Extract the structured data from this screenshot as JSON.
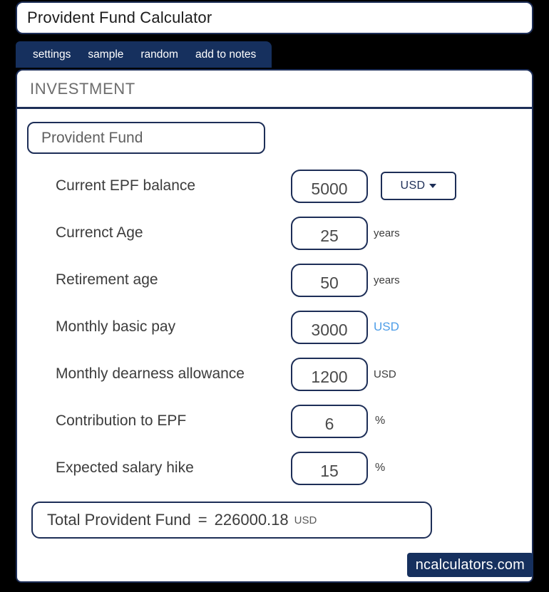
{
  "window": {
    "title": "Provident Fund Calculator"
  },
  "tabs": [
    {
      "label": "settings",
      "name": "tab-settings"
    },
    {
      "label": "sample",
      "name": "tab-sample"
    },
    {
      "label": "random",
      "name": "tab-random"
    },
    {
      "label": "add to notes",
      "name": "tab-add-to-notes"
    }
  ],
  "section": {
    "title": "INVESTMENT"
  },
  "investment_type": {
    "selected": "Provident Fund"
  },
  "fields": [
    {
      "label": "Current EPF balance",
      "value": "5000",
      "unit": "",
      "unit_style": "none",
      "has_currency_dropdown": true
    },
    {
      "label": "Currenct Age",
      "value": "25",
      "unit": "years",
      "unit_style": "plain",
      "has_currency_dropdown": false
    },
    {
      "label": "Retirement age",
      "value": "50",
      "unit": "years",
      "unit_style": "plain",
      "has_currency_dropdown": false
    },
    {
      "label": "Monthly basic pay",
      "value": "3000",
      "unit": "USD",
      "unit_style": "link",
      "has_currency_dropdown": false
    },
    {
      "label": "Monthly dearness allowance",
      "value": "1200",
      "unit": "USD",
      "unit_style": "plain",
      "has_currency_dropdown": false
    },
    {
      "label": "Contribution to EPF",
      "value": "6",
      "unit": "%",
      "unit_style": "pct",
      "has_currency_dropdown": false
    },
    {
      "label": "Expected salary hike",
      "value": "15",
      "unit": "%",
      "unit_style": "pct",
      "has_currency_dropdown": false
    }
  ],
  "currency_dropdown": {
    "selected": "USD",
    "icon": "chevron-down-icon"
  },
  "result": {
    "label": "Total Provident Fund",
    "equals": "=",
    "value": "226000.18",
    "unit": "USD"
  },
  "watermark": {
    "text": "ncalculators.com"
  },
  "colors": {
    "navy": "#1d2e57",
    "tab_bar": "#16305e",
    "background": "#000000",
    "label_text": "#3c3c3c",
    "link_blue": "#4d9de8",
    "section_title": "#6d6d6d"
  }
}
